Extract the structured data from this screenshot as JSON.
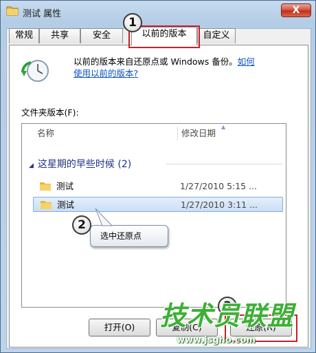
{
  "window": {
    "title": "测试 属性",
    "close_label": "X"
  },
  "tabs": [
    {
      "label": "常规"
    },
    {
      "label": "共享"
    },
    {
      "label": "安全"
    },
    {
      "label": "以前的版本"
    },
    {
      "label": "自定义"
    }
  ],
  "info": {
    "text": "以前的版本来自还原点或 Windows 备份。",
    "link_part1": "如何",
    "link_part2": "使用以前的版本?"
  },
  "list": {
    "section_label": "文件夹版本(F):",
    "col_name": "名称",
    "col_date": "修改日期",
    "sort_indicator": "▲",
    "group_collapse": "◢",
    "group_header": "这星期的早些时候 (2)",
    "rows": [
      {
        "name": "测试",
        "date": "1/27/2010 5:15 ..."
      },
      {
        "name": "测试",
        "date": "1/27/2010 3:11 ..."
      }
    ]
  },
  "annotations": {
    "step1": "1",
    "step2": "2",
    "step3": "3",
    "callout": "选中还原点"
  },
  "buttons": {
    "open": "打开(O)",
    "copy": "复制(C)",
    "restore": "还原(R)"
  },
  "watermark": {
    "text": "技术员联盟",
    "url": "www.jsgho.com"
  },
  "colors": {
    "accent_red": "#c62028",
    "link": "#0b52c4",
    "group_header": "#1e3287",
    "watermark_green": "#3cb035"
  }
}
